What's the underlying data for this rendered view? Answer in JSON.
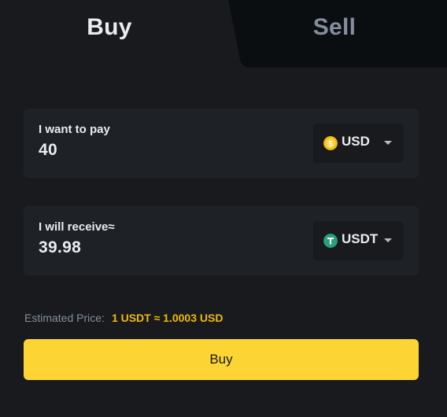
{
  "tabs": {
    "buy_label": "Buy",
    "sell_label": "Sell",
    "active": "buy"
  },
  "pay": {
    "label": "I want to pay",
    "amount": "40",
    "currency": "USD",
    "currency_icon": "usd-coin-icon"
  },
  "receive": {
    "label": "I will receive≈",
    "amount": "39.98",
    "currency": "USDT",
    "currency_icon": "tether-coin-icon"
  },
  "estimate": {
    "label": "Estimated Price:",
    "value": "1 USDT ≈ 1.0003 USD"
  },
  "action": {
    "buy_label": "Buy"
  },
  "colors": {
    "background": "#181a1d",
    "card": "#1e2226",
    "accent": "#fcd535",
    "price_text": "#f0b90b",
    "usd_coin": "#f0b90b",
    "tether_coin": "#26a17b"
  }
}
